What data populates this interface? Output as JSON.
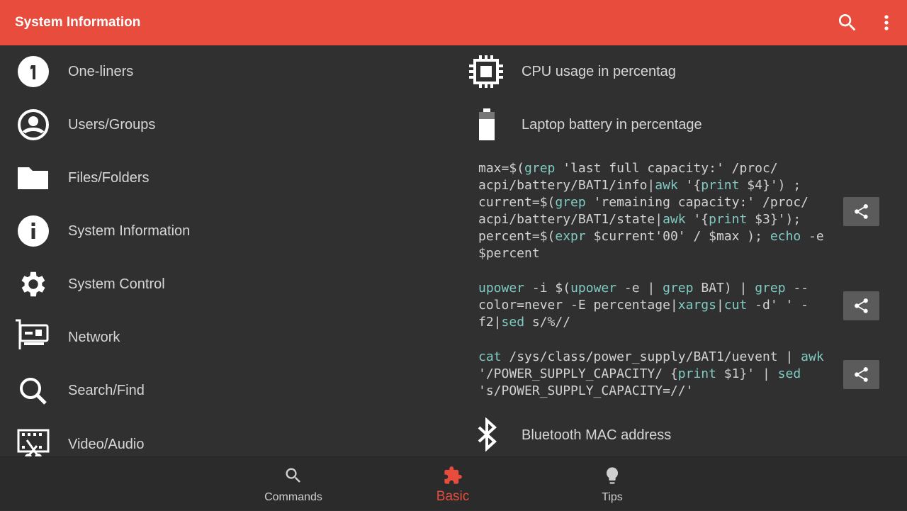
{
  "appbar": {
    "title": "System Information",
    "icons": [
      "search-icon",
      "more-vert-icon"
    ]
  },
  "sidebar": {
    "items": [
      {
        "label": "One-liners",
        "icon": "looks-one-icon"
      },
      {
        "label": "Users/Groups",
        "icon": "account-circle-icon"
      },
      {
        "label": "Files/Folders",
        "icon": "folder-icon"
      },
      {
        "label": "System Information",
        "icon": "info-icon"
      },
      {
        "label": "System Control",
        "icon": "gear-icon"
      },
      {
        "label": "Network",
        "icon": "network-card-icon"
      },
      {
        "label": "Search/Find",
        "icon": "search-icon"
      },
      {
        "label": "Video/Audio",
        "icon": "video-edit-icon"
      }
    ]
  },
  "main": {
    "cpu": {
      "label": "CPU usage in percentag",
      "icon": "cpu-icon"
    },
    "battery": {
      "label": "Laptop battery in percentage",
      "icon": "battery-icon"
    },
    "bluetooth": {
      "label": "Bluetooth MAC address",
      "icon": "bluetooth-icon"
    },
    "commands": [
      {
        "lines": [
          [
            [
              "max=$(",
              0
            ],
            [
              "grep",
              1
            ],
            [
              " 'last full capacity:' /proc/",
              0
            ]
          ],
          [
            [
              "acpi/battery/BAT1/info|",
              0
            ],
            [
              "awk",
              1
            ],
            [
              " '{",
              0
            ],
            [
              "print",
              1
            ],
            [
              " $4}') ;",
              0
            ]
          ],
          [
            [
              "current=$(",
              0
            ],
            [
              "grep",
              1
            ],
            [
              " 'remaining capacity:' /proc/",
              0
            ]
          ],
          [
            [
              "acpi/battery/BAT1/state|",
              0
            ],
            [
              "awk",
              1
            ],
            [
              " '{",
              0
            ],
            [
              "print",
              1
            ],
            [
              " $3}');",
              0
            ]
          ],
          [
            [
              "percent=$(",
              0
            ],
            [
              "expr",
              1
            ],
            [
              " $current'00' / $max ); ",
              0
            ],
            [
              "echo",
              1
            ],
            [
              " -e",
              0
            ]
          ],
          [
            [
              "$percent",
              0
            ]
          ]
        ]
      },
      {
        "lines": [
          [
            [
              "upower",
              1
            ],
            [
              " -i $(",
              0
            ],
            [
              "upower",
              1
            ],
            [
              " -e | ",
              0
            ],
            [
              "grep",
              1
            ],
            [
              " BAT) | ",
              0
            ],
            [
              "grep",
              1
            ],
            [
              " --",
              0
            ]
          ],
          [
            [
              "color=never -E percentage|",
              0
            ],
            [
              "xargs",
              1
            ],
            [
              "|",
              0
            ],
            [
              "cut",
              1
            ],
            [
              " -d' ' -",
              0
            ]
          ],
          [
            [
              "f2|",
              0
            ],
            [
              "sed",
              1
            ],
            [
              " s/%//",
              0
            ]
          ]
        ]
      },
      {
        "lines": [
          [
            [
              "cat",
              1
            ],
            [
              " /sys/class/power_supply/BAT1/uevent | ",
              0
            ],
            [
              "awk",
              1
            ]
          ],
          [
            [
              "'/POWER_SUPPLY_CAPACITY/ {",
              0
            ],
            [
              "print",
              1
            ],
            [
              " $1}' | ",
              0
            ],
            [
              "sed",
              1
            ]
          ],
          [
            [
              "'s/POWER_SUPPLY_CAPACITY=//'",
              0
            ]
          ]
        ]
      }
    ]
  },
  "bottom_nav": {
    "tabs": [
      {
        "label": "Commands",
        "icon": "search-icon"
      },
      {
        "label": "Basic",
        "icon": "extension-icon",
        "active": true
      },
      {
        "label": "Tips",
        "icon": "lightbulb-icon"
      }
    ]
  },
  "colors": {
    "accent": "#e84c3d",
    "code_keyword": "#80cbc4",
    "background": "#303030"
  }
}
